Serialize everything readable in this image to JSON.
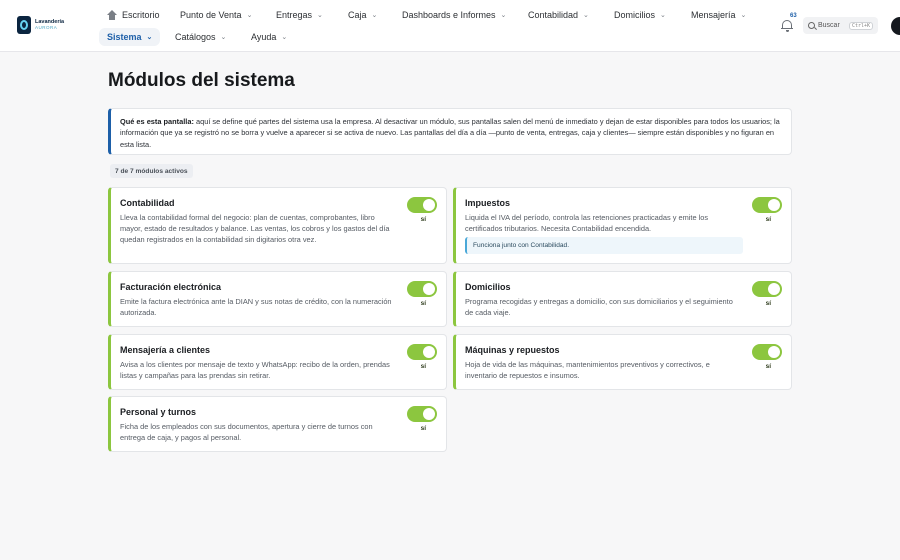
{
  "brand": {
    "name": "Lavandería",
    "subtitle": "AURORA"
  },
  "nav": {
    "top": [
      {
        "label": "Escritorio"
      },
      {
        "label": "Punto de Venta"
      },
      {
        "label": "Entregas"
      },
      {
        "label": "Caja"
      },
      {
        "label": "Dashboards e Informes"
      },
      {
        "label": "Contabilidad"
      },
      {
        "label": "Domicilios"
      },
      {
        "label": "Mensajería"
      }
    ],
    "second": [
      {
        "label": "Sistema",
        "active": true
      },
      {
        "label": "Catálogos"
      },
      {
        "label": "Ayuda"
      }
    ]
  },
  "notifications": {
    "count": "63"
  },
  "search": {
    "label": "Buscar",
    "shortcut": "Ctrl+K"
  },
  "page": {
    "title": "Módulos del sistema"
  },
  "info": {
    "strong": "Qué es esta pantalla:",
    "text": " aquí se define qué partes del sistema usa la empresa. Al desactivar un módulo, sus pantallas salen del menú de inmediato y dejan de estar disponibles para todos los usuarios; la información que ya se registró no se borra y vuelve a aparecer si se activa de nuevo. Las pantallas del día a día —punto de venta, entregas, caja y clientes— siempre están disponibles y no figuran en esta lista."
  },
  "summary": {
    "active_count": "7 de 7 módulos activos"
  },
  "modules": [
    {
      "title": "Contabilidad",
      "desc": "Lleva la contabilidad formal del negocio: plan de cuentas, comprobantes, libro mayor, estado de resultados y balance. Las ventas, los cobros y los gastos del día quedan registrados en la contabilidad sin digitarios otra vez.",
      "state": "sí",
      "enabled": true
    },
    {
      "title": "Impuestos",
      "desc": "Liquida el IVA del período, controla las retenciones practicadas y emite los certificados tributarios. Necesita Contabilidad encendida.",
      "state": "sí",
      "enabled": true,
      "note": "Funciona junto con Contabilidad."
    },
    {
      "title": "Facturación electrónica",
      "desc": "Emite la factura electrónica ante la DIAN y sus notas de crédito, con la numeración autorizada.",
      "state": "sí",
      "enabled": true
    },
    {
      "title": "Domicilios",
      "desc": "Programa recogidas y entregas a domicilio, con sus domiciliarios y el seguimiento de cada viaje.",
      "state": "sí",
      "enabled": true
    },
    {
      "title": "Mensajería a clientes",
      "desc": "Avisa a los clientes por mensaje de texto y WhatsApp: recibo de la orden, prendas listas y campañas para las prendas sin retirar.",
      "state": "sí",
      "enabled": true
    },
    {
      "title": "Máquinas y repuestos",
      "desc": "Hoja de vida de las máquinas, mantenimientos preventivos y correctivos, e inventario de repuestos e insumos.",
      "state": "sí",
      "enabled": true
    },
    {
      "title": "Personal y turnos",
      "desc": "Ficha de los empleados con sus documentos, apertura y cierre de turnos con entrega de caja, y pagos al personal.",
      "state": "sí",
      "enabled": true
    }
  ],
  "colors": {
    "accent": "#1d5fa8",
    "module_on": "#8cc63f",
    "note": "#4aa8d8"
  }
}
